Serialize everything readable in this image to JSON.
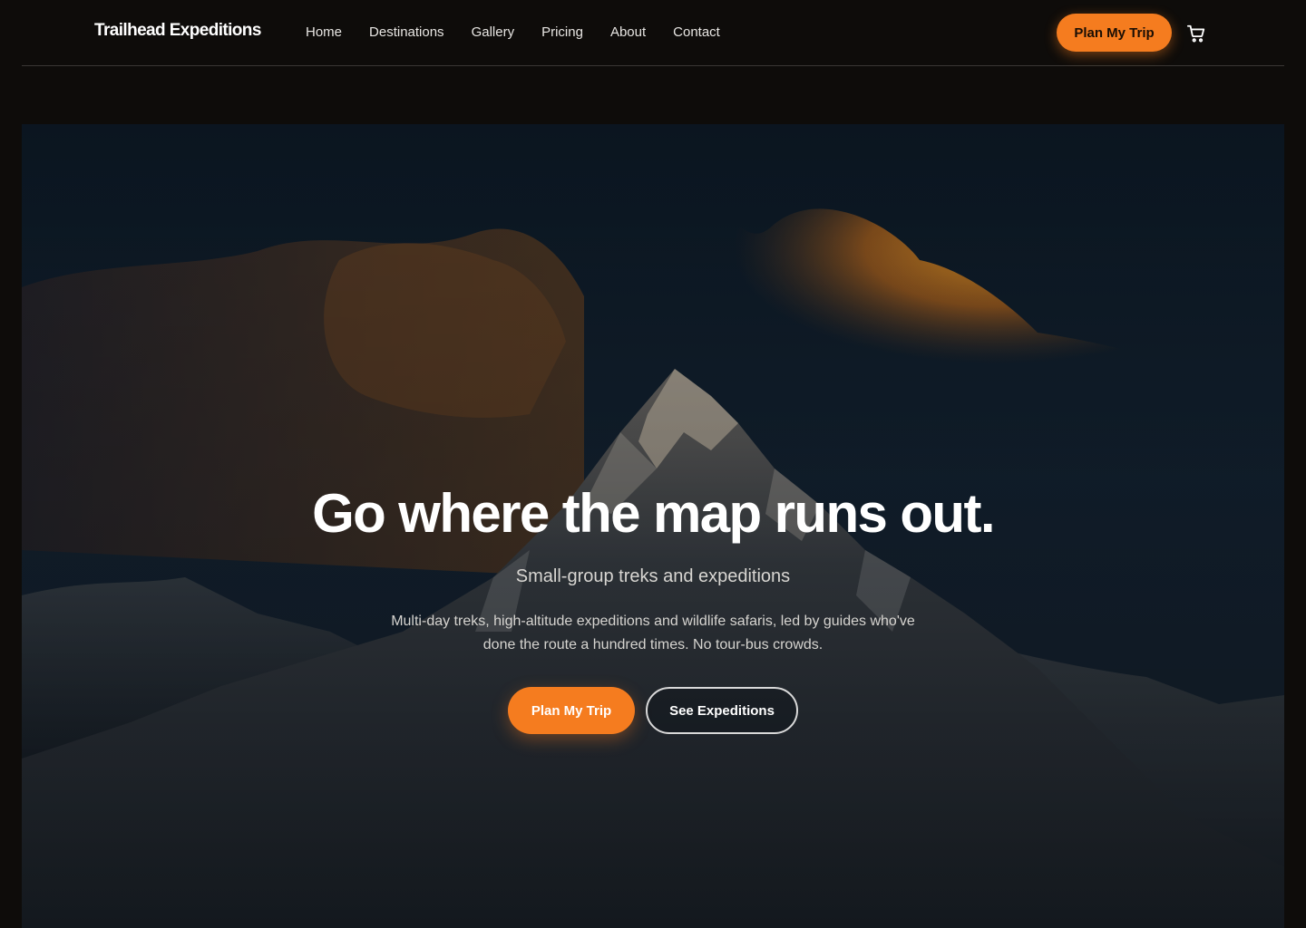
{
  "nav": {
    "brand": "Trailhead Expeditions",
    "links": [
      {
        "label": "Home"
      },
      {
        "label": "Destinations"
      },
      {
        "label": "Gallery"
      },
      {
        "label": "Pricing"
      },
      {
        "label": "About"
      },
      {
        "label": "Contact"
      }
    ],
    "cta_label": "Plan My Trip",
    "cart_icon": "cart-icon"
  },
  "hero": {
    "title": "Go where the map runs out.",
    "subtitle": "Small-group treks and expeditions",
    "description": "Multi-day treks, high-altitude expeditions and wildlife safaris, led by guides who've done the route a hundred times. No tour-bus crowds.",
    "primary_label": "Plan My Trip",
    "secondary_label": "See Expeditions",
    "background": "mountain-peak-at-sunset-image"
  },
  "colors": {
    "accent": "#f57c1f",
    "page_background": "#0e0c0a",
    "nav_divider": "#3a3734"
  }
}
